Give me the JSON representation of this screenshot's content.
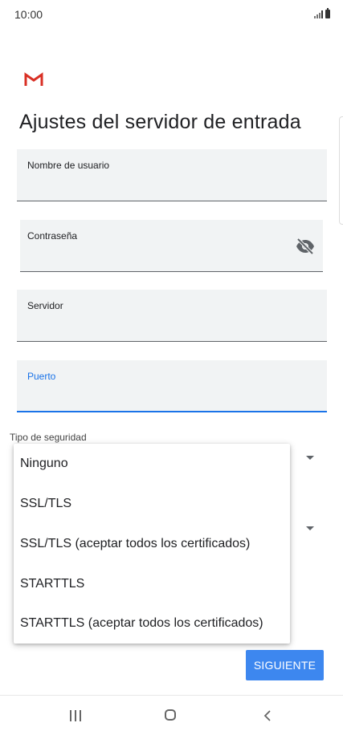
{
  "status_bar": {
    "time": "10:00",
    "icons": [
      "signal-icon",
      "battery-icon"
    ]
  },
  "header": {
    "logo": "gmail-logo",
    "logo_color": "#d93025",
    "title": "Ajustes del servidor de entrada"
  },
  "form": {
    "username": {
      "label": "Nombre de usuario",
      "value": ""
    },
    "password": {
      "label": "Contraseña",
      "value": "",
      "toggle_icon": "eye-off-icon"
    },
    "server": {
      "label": "Servidor",
      "value": ""
    },
    "port": {
      "label": "Puerto",
      "value": "",
      "focused": true
    },
    "security_type": {
      "label": "Tipo de seguridad"
    }
  },
  "dropdown": {
    "options": [
      "Ninguno",
      "SSL/TLS",
      "SSL/TLS (aceptar todos los certificados)",
      "STARTTLS",
      "STARTTLS (aceptar todos los certificados)"
    ]
  },
  "actions": {
    "next_label": "SIGUIENTE"
  },
  "colors": {
    "accent": "#1a73e8",
    "button": "#3d87ef",
    "field_bg": "#f1f3f4"
  },
  "nav_bar": {
    "icons": [
      "recent-apps-icon",
      "home-icon",
      "back-icon"
    ]
  }
}
